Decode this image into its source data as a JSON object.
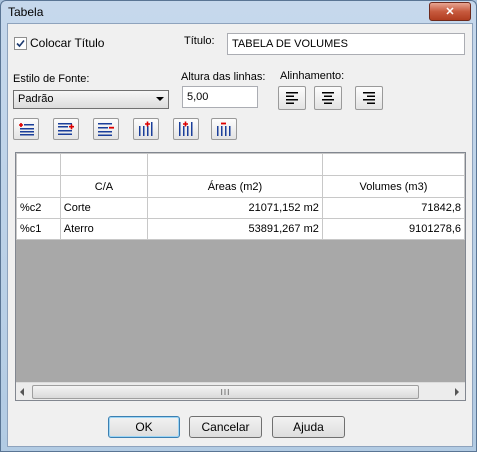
{
  "window": {
    "title": "Tabela",
    "close_glyph": "✕"
  },
  "options": {
    "colocar_titulo_label": "Colocar Título",
    "colocar_titulo_checked": true,
    "titulo_label": "Título:",
    "titulo_value": "TABELA DE VOLUMES",
    "estilo_fonte_label": "Estilo de Fonte:",
    "estilo_fonte_value": "Padrão",
    "altura_linhas_label": "Altura das linhas:",
    "altura_linhas_value": "5,00",
    "alinhamento_label": "Alinhamento:",
    "alinhamento_buttons": [
      "align-left-icon",
      "align-center-icon",
      "align-right-icon"
    ]
  },
  "toolbar_icons": [
    "insert-row-above-icon",
    "insert-row-below-icon",
    "delete-row-icon",
    "insert-column-icon",
    "insert-column-left-icon",
    "delete-column-icon"
  ],
  "table": {
    "header_row1": [
      "",
      "",
      "",
      ""
    ],
    "header_row2": [
      "",
      "C/A",
      "Áreas (m2)",
      "Volumes (m3)"
    ],
    "rows": [
      [
        "%c2",
        "Corte",
        "21071,152 m2",
        "71842,8"
      ],
      [
        "%c1",
        "Aterro",
        "53891,267 m2",
        "9101278,6"
      ]
    ],
    "scroll_thumb_glyph": "III"
  },
  "buttons": {
    "ok": "OK",
    "cancel": "Cancelar",
    "help": "Ajuda"
  }
}
